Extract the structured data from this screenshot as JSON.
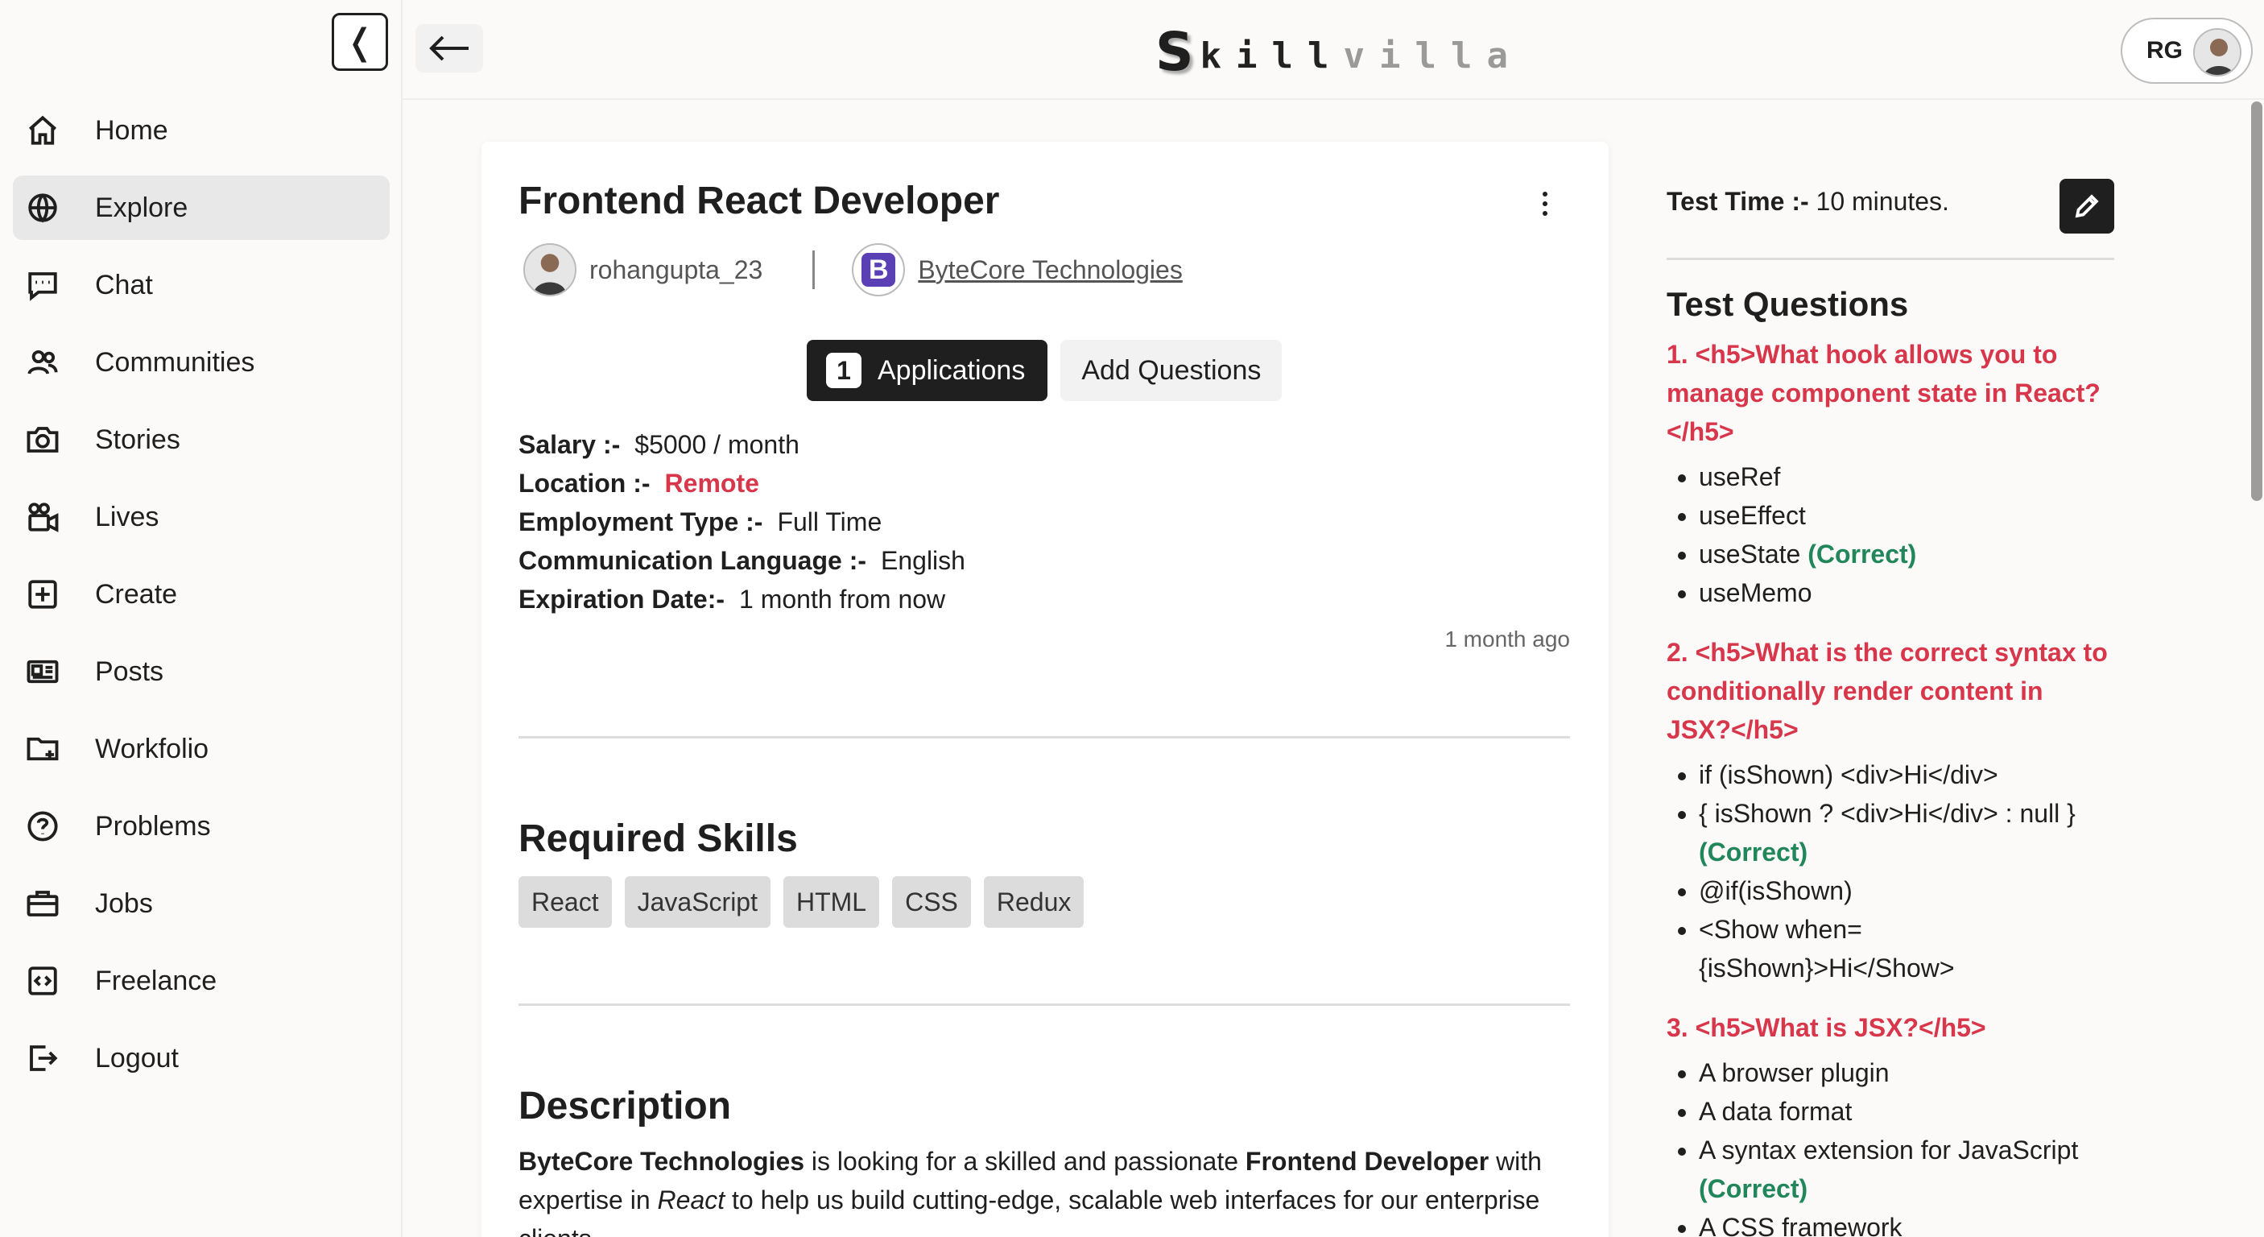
{
  "sidebar": {
    "items": [
      {
        "label": "Home",
        "icon": "home-icon"
      },
      {
        "label": "Explore",
        "icon": "globe-icon",
        "active": true
      },
      {
        "label": "Chat",
        "icon": "chat-icon"
      },
      {
        "label": "Communities",
        "icon": "users-icon"
      },
      {
        "label": "Stories",
        "icon": "camera-icon"
      },
      {
        "label": "Lives",
        "icon": "video-camera-icon"
      },
      {
        "label": "Create",
        "icon": "plus-square-icon"
      },
      {
        "label": "Posts",
        "icon": "newspaper-icon"
      },
      {
        "label": "Workfolio",
        "icon": "folder-plus-icon"
      },
      {
        "label": "Problems",
        "icon": "question-circle-icon"
      },
      {
        "label": "Jobs",
        "icon": "briefcase-icon"
      },
      {
        "label": "Freelance",
        "icon": "code-square-icon"
      },
      {
        "label": "Logout",
        "icon": "logout-icon"
      }
    ]
  },
  "header": {
    "logo_s": "S",
    "logo_mid": "kill",
    "logo_end": "villa",
    "user_initials": "RG"
  },
  "job": {
    "title": "Frontend React Developer",
    "username": "rohangupta_23",
    "company_initial": "B",
    "company": "ByteCore Technologies",
    "applications_count": "1",
    "applications_label": "Applications",
    "add_questions_label": "Add Questions",
    "salary_label": "Salary :-",
    "salary_value": "$5000 / month",
    "location_label": "Location :-",
    "location_value": "Remote",
    "employment_label": "Employment Type :-",
    "employment_value": "Full Time",
    "language_label": "Communication Language :-",
    "language_value": "English",
    "expiration_label": "Expiration Date:-",
    "expiration_value": "1 month from now",
    "posted": "1 month ago",
    "skills_title": "Required Skills",
    "skills": [
      "React",
      "JavaScript",
      "HTML",
      "CSS",
      "Redux"
    ],
    "description_title": "Description",
    "description": {
      "company": "ByteCore Technologies",
      "t1": " is looking for a skilled and passionate ",
      "role": "Frontend Developer",
      "t2": " with expertise in ",
      "tech": "React",
      "t3": " to help us build cutting-edge, scalable web interfaces for our enterprise clients."
    }
  },
  "test": {
    "time_label": "Test Time :-",
    "time_value": "10 minutes.",
    "questions_title": "Test Questions",
    "correct_label": "(Correct)",
    "questions": [
      {
        "text": "1. <h5>What hook allows you to manage component state in React?</h5>",
        "options": [
          "useRef",
          "useEffect",
          "useState",
          "useMemo"
        ],
        "correct": 2
      },
      {
        "text": "2. <h5>What is the correct syntax to conditionally render content in JSX?</h5>",
        "options": [
          "if (isShown) <div>Hi</div>",
          "{ isShown ? <div>Hi</div> : null }",
          "@if(isShown)",
          "<Show when={isShown}>Hi</Show>"
        ],
        "correct": 1
      },
      {
        "text": "3. <h5>What is JSX?</h5>",
        "options": [
          "A browser plugin",
          "A data format",
          "A syntax extension for JavaScript",
          "A CSS framework"
        ],
        "correct": 2
      }
    ]
  },
  "colors": {
    "accent_red": "#d8364a",
    "correct_green": "#21875a",
    "dark": "#1f1f1f"
  }
}
